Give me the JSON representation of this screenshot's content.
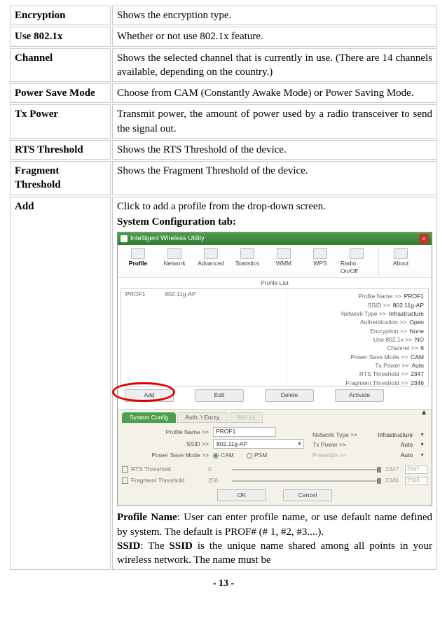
{
  "rows": {
    "encryption": {
      "label": "Encryption",
      "desc": "Shows the encryption type."
    },
    "use8021x": {
      "label": "Use 802.1x",
      "desc": "Whether or not use 802.1x feature."
    },
    "channel": {
      "label": "Channel",
      "desc": "Shows the selected channel that is currently in use. (There are 14 channels available, depending on the country.)"
    },
    "powersave": {
      "label": "Power Save Mode",
      "desc": "Choose from CAM (Constantly Awake Mode) or Power Saving Mode."
    },
    "txpower": {
      "label": "Tx Power",
      "desc": "Transmit power, the amount of power used by a radio transceiver to send the signal out."
    },
    "rts": {
      "label": "RTS Threshold",
      "desc": "Shows the RTS Threshold of the device."
    },
    "frag": {
      "label": "Fragment Threshold",
      "desc": "Shows the Fragment Threshold of the device."
    },
    "add": {
      "label": "Add",
      "desc_intro": "Click to add a profile from the drop-down screen.",
      "sys_tab_label": "System Configuration tab:"
    }
  },
  "add_body": {
    "profile_name": {
      "label": "Profile Name",
      "text": ": User can enter profile name, or use default name defined by system. The default is PROF# (# 1, #2, #3....)."
    },
    "ssid": {
      "label": "SSID",
      "text1": ": The ",
      "text2": " is the unique name shared among all points in your wireless network. The name must be"
    }
  },
  "screenshot": {
    "title": "Intelligent Wireless Utility",
    "close": "×",
    "toolbar": [
      "Profile",
      "Network",
      "Advanced",
      "Statistics",
      "WMM",
      "WPS",
      "Radio On/Off",
      "About"
    ],
    "profile_list_header": "Profile List",
    "list_col1": "PROF1",
    "list_col2": "802.11g-AP",
    "right_kv": [
      [
        "Profile Name >>",
        "PROF1"
      ],
      [
        "SSID >>",
        "802.11g-AP"
      ],
      [
        "Network Type >>",
        "Infrastructure"
      ],
      [
        "Authentication >>",
        "Open"
      ],
      [
        "Encryption >>",
        "None"
      ],
      [
        "Use 802.1x >>",
        "NO"
      ],
      [
        "Channel >>",
        "6"
      ],
      [
        "Power Save Mode >>",
        "CAM"
      ],
      [
        "Tx Power >>",
        "Auto"
      ],
      [
        "RTS Threshold >>",
        "2347"
      ],
      [
        "Fragment Threshold >>",
        "2346"
      ]
    ],
    "buttons": [
      "Add",
      "Edit",
      "Delete",
      "Activate"
    ],
    "lower": {
      "tabs": [
        "System Config",
        "Auth. \\ Encry.",
        "802.1x"
      ],
      "profile_name_label": "Profile Name >>",
      "profile_name_value": "PROF1",
      "ssid_label": "SSID >>",
      "ssid_value": "802.11g-AP",
      "pwr_label": "Power Save Mode >>",
      "pwr_cam": "CAM",
      "pwr_psm": "PSM",
      "rts_label": "RTS Threshold",
      "rts_val_a": "0",
      "rts_val_b": "2347",
      "rts_box": "2347",
      "frag_label": "Fragment Threshold",
      "frag_val_a": "256",
      "frag_val_b": "2346",
      "frag_box": "2346",
      "right": {
        "net_type_l": "Network Type >>",
        "net_type_v": "Infrastructure",
        "txpower_l": "Tx Power >>",
        "txpower_v": "Auto",
        "preamble_l": "Preamble >>",
        "preamble_v": "Auto"
      },
      "ok": "OK",
      "cancel": "Cancel"
    }
  },
  "page_num": "- 13 -"
}
